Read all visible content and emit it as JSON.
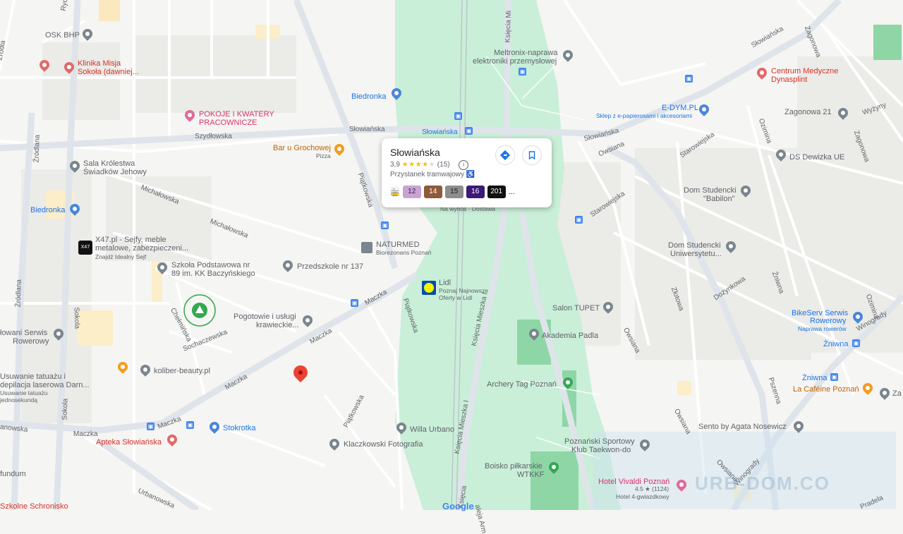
{
  "colors": {
    "map_bg": "#f5f5f3",
    "road": "#ffffff",
    "major_road": "#dfe4ea",
    "park": "#c9efd8",
    "pin_gray": "#7a858e",
    "pin_blue": "#4a86d9",
    "pin_red": "#e06a6a",
    "pin_orange": "#f29c1f",
    "pin_green": "#34a853",
    "pin_pink": "#e06a98",
    "selected_pin": "#ea4335"
  },
  "card": {
    "title": "Słowiańska",
    "rating": "3,9",
    "stars_filled": "★★★★",
    "stars_empty": "★",
    "reviews": "(15)",
    "type": "Przystanek tramwajowy",
    "lines": [
      {
        "label": "12",
        "bg": "#c9a3d4",
        "fg": "#3c1f47"
      },
      {
        "label": "14",
        "bg": "#8e5b3a",
        "fg": "#ffffff"
      },
      {
        "label": "15",
        "bg": "#8d8d8d",
        "fg": "#1b1b1b"
      },
      {
        "label": "16",
        "bg": "#3d1a78",
        "fg": "#ffffff"
      },
      {
        "label": "201",
        "bg": "#111111",
        "fg": "#ffffff"
      }
    ],
    "more": "...",
    "directions_icon": "directions-icon",
    "save_icon": "bookmark-icon"
  },
  "pois": [
    {
      "id": "osk",
      "name": "OSK BHP",
      "icon": "gray"
    },
    {
      "id": "klinika",
      "name": "Klinika Misja",
      "name2": "Sokoła (dawniej...",
      "icon": "red"
    },
    {
      "id": "pokoje",
      "name": "POKOJE I KWATERY",
      "name2": "PRACOWNICZE",
      "icon": "pink"
    },
    {
      "id": "bar",
      "name": "Bar u Grochowej",
      "sub": "Pizza",
      "icon": "orange"
    },
    {
      "id": "biedronka1",
      "name": "Biedronka",
      "icon": "blue"
    },
    {
      "id": "meltronix",
      "name": "Meltronix-naprawa",
      "name2": "elektroniki przemysłowej",
      "icon": "gray"
    },
    {
      "id": "centrum",
      "name": "Centrum Medyczne",
      "name2": "Dynasplint",
      "icon": "red"
    },
    {
      "id": "edym",
      "name": "E-DYM.PL",
      "sub": "Sklep z e-papierosami i akcesoriami",
      "icon": "blue"
    },
    {
      "id": "zagonowa21",
      "name": "Zagonowa 21",
      "icon": "gray"
    },
    {
      "id": "dsdewizka",
      "name": "DS Dewizka UE",
      "icon": "gray"
    },
    {
      "id": "sala",
      "name": "Sala Królestwa",
      "name2": "Świadków Jehowy",
      "icon": "gray"
    },
    {
      "id": "biedronka2",
      "name": "Biedronka",
      "icon": "blue"
    },
    {
      "id": "babilon",
      "name": "Dom Studencki",
      "name2": "\"Babilon\"",
      "icon": "gray"
    },
    {
      "id": "x47",
      "name": "X47.pl - Sejfy, meble",
      "name2": "metalowe, zabezpieczeni...",
      "sub": "Znajdź Idealny Sejf",
      "icon": "gray"
    },
    {
      "id": "naturmed",
      "name": "NATURMED",
      "sub": "Biorezonans Poznań",
      "icon": "gray"
    },
    {
      "id": "uniwersytetu",
      "name": "Dom Studencki",
      "name2": "Uniwersytetu...",
      "icon": "gray"
    },
    {
      "id": "szkola",
      "name": "Szkoła Podstawowa nr",
      "name2": "89 im. KK Baczyńskiego",
      "icon": "gray"
    },
    {
      "id": "przedszkole",
      "name": "Przedszkole nr 137",
      "icon": "gray"
    },
    {
      "id": "lidl",
      "name": "Lidl",
      "sub": "Poznaj Najnowsze",
      "sub2": "Oferty w Lidl",
      "icon": "lidl"
    },
    {
      "id": "salon",
      "name": "Salon TUPET",
      "icon": "gray"
    },
    {
      "id": "bikeserv",
      "name": "BikeServ Serwis",
      "name2": "Rowerowy",
      "sub": "Naprawa rowerów",
      "icon": "blue"
    },
    {
      "id": "pogotowie",
      "name": "Pogotowie i usługi",
      "name2": "krawieckie...",
      "icon": "gray"
    },
    {
      "id": "akademia",
      "name": "Akademia Padla",
      "icon": "gray"
    },
    {
      "id": "zniwna1",
      "name": "Żniwna",
      "icon": "blue"
    },
    {
      "id": "serwis",
      "name": "łowani Serwis",
      "name2": "Rowerowy",
      "icon": "gray"
    },
    {
      "id": "koliber",
      "name": "koliber-beauty.pl",
      "icon": "gray"
    },
    {
      "id": "usuwanie",
      "name": "Usuwanie tatuażu i",
      "name2": "depilacja laserowa Darn...",
      "sub": "Usuwanie tatuażu",
      "sub2": "jednosekundą",
      "icon": "gray"
    },
    {
      "id": "archery",
      "name": "Archery Tag Poznań",
      "icon": "green"
    },
    {
      "id": "zniwna2",
      "name": "Żniwna",
      "icon": "blue"
    },
    {
      "id": "lacafeine",
      "name": "La Caféine Poznań",
      "icon": "orange"
    },
    {
      "id": "zacy",
      "name": "Za Cy",
      "icon": "gray"
    },
    {
      "id": "sento",
      "name": "Sento by Agata Nosewicz",
      "icon": "gray"
    },
    {
      "id": "stokrotka",
      "name": "Stokrotka",
      "icon": "blue"
    },
    {
      "id": "willa",
      "name": "Willa Urbano",
      "icon": "gray"
    },
    {
      "id": "apteka",
      "name": "Apteka Słowiańska",
      "icon": "red"
    },
    {
      "id": "klaczkowski",
      "name": "Klaczkowski Fotografia",
      "icon": "gray"
    },
    {
      "id": "taekwondo",
      "name": "Poznański Sportowy",
      "name2": "Klub Taekwon-do",
      "icon": "gray"
    },
    {
      "id": "boisko",
      "name": "Boisko piłkarskie",
      "name2": "WTKKF",
      "icon": "green"
    },
    {
      "id": "vivaldi",
      "name": "Hotel Vivaldi Poznań",
      "rating": "4.5 ★ (1124)",
      "sub": "Hotel 4-gwiazdkowy",
      "icon": "pink"
    },
    {
      "id": "fundum",
      "name": "fundum",
      "icon": "none"
    },
    {
      "id": "schronisko",
      "name": "Szkolne Schronisko",
      "icon": "none"
    },
    {
      "id": "nawynos",
      "name": "Na wynos · Dostawa",
      "icon": "none"
    }
  ],
  "streets": {
    "slowianska1": "Słowiańska",
    "slowianska2": "Słowiańska",
    "slowianska3": "Słowiańska",
    "slowianska_stop": "Słowiańska",
    "szydlowska": "Szydłowska",
    "ksiecia1": "Księcia Mi",
    "ksiecia2": "Księcia Mieszka I",
    "ksiecia3": "Księcia Mieszka I",
    "ksiecia4": "Księcia",
    "zagonowa1": "Zagonowa",
    "zagonowa2": "Zagonowa",
    "wyzyny": "Wyżyny",
    "owsiana1": "Owsiana",
    "owsiana2": "Owsiana",
    "owsiana3": "Owsiana",
    "owsiana4": "Owsiana",
    "ozimina1": "Ozimina",
    "ozimina2": "Ozimina",
    "starowiejska1": "Starowiejska",
    "starowiejska2": "Starowiejska",
    "dozynkowa": "Dożynkowa",
    "zniwna": "Żniwna",
    "zlotowa": "Złotowa",
    "winogrady1": "Winogrady",
    "winogrady2": "Winogrady",
    "pszenna": "Pszenna",
    "zrodlana1": "Źródlana",
    "zrodlana2": "Źródlana",
    "sokola1": "Sokola",
    "sokola2": "Sokola",
    "michalowska1": "Michałowska",
    "michalowska2": "Michałowska",
    "piatkowska1": "Piątkowska",
    "piatkowska2": "Piątkowska",
    "piatkowska3": "Piątkowska",
    "maczka1": "Maczka",
    "maczka2": "Maczka",
    "maczka3": "Maczka",
    "maczka4": "Maczka",
    "maczka5": "Maczka",
    "chelminska": "Chełmińska",
    "sochaczewska": "Sochaczewska",
    "urbanowska1": "Urbanowska",
    "urbanowska2": "anowska",
    "rydla": "Rydla",
    "aleja": "aleja Arm",
    "zrodla_top": "Źrodla",
    "pradela": "Pradela"
  },
  "watermark": "URB-DOM.CO",
  "google": "Google"
}
